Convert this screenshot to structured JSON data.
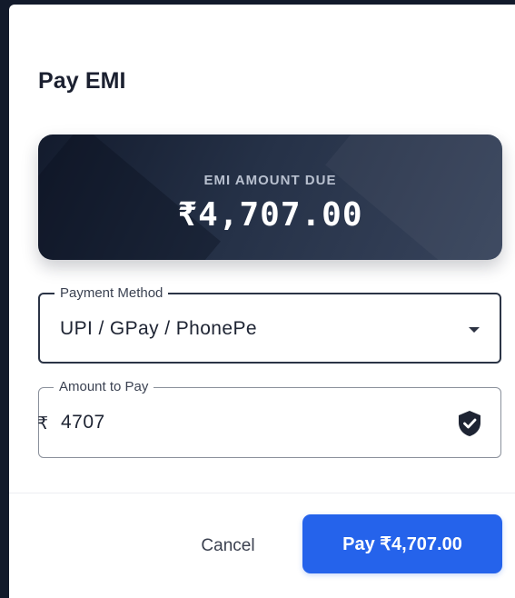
{
  "dialog": {
    "title": "Pay EMI"
  },
  "emi_card": {
    "label": "EMI AMOUNT DUE",
    "amount": "₹4,707.00"
  },
  "payment_method": {
    "legend": "Payment Method",
    "selected": "UPI / GPay / PhonePe"
  },
  "amount_to_pay": {
    "legend": "Amount to Pay",
    "currency_symbol": "₹",
    "value": "4707",
    "icon": "shield-check-icon"
  },
  "actions": {
    "cancel_label": "Cancel",
    "pay_label": "Pay ₹4,707.00"
  },
  "colors": {
    "accent": "#2563eb",
    "card_dark": "#131b2d",
    "backdrop": "#121a2b"
  }
}
